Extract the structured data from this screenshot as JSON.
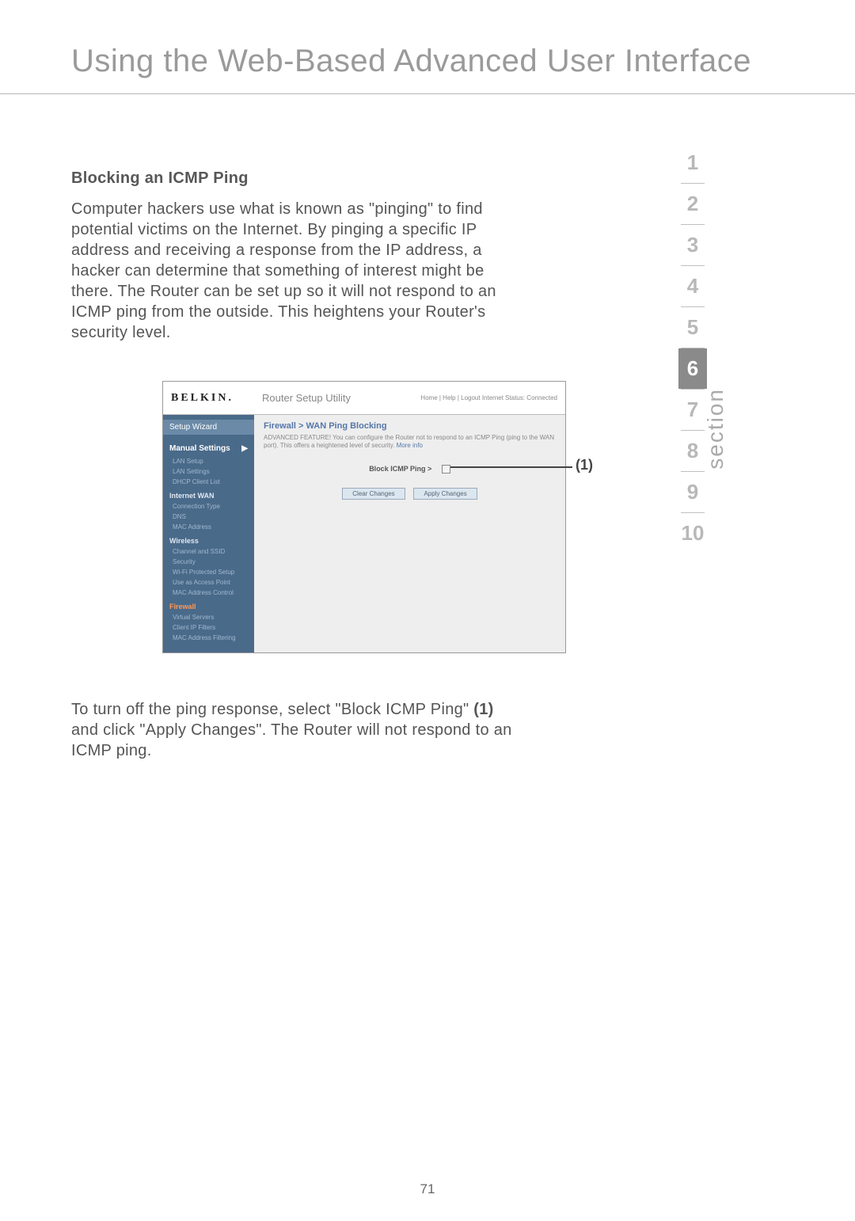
{
  "page": {
    "title": "Using the Web-Based Advanced User Interface",
    "number": "71",
    "section_word": "section"
  },
  "nav": {
    "items": [
      "1",
      "2",
      "3",
      "4",
      "5",
      "6",
      "7",
      "8",
      "9",
      "10"
    ],
    "active_index": 5
  },
  "article": {
    "subhead": "Blocking an ICMP Ping",
    "body": "Computer hackers use what is known as \"pinging\" to find potential victims on the Internet. By pinging a specific IP address and receiving a response from the IP address, a hacker can determine that something of interest might be there. The Router can be set up so it will not respond to an ICMP ping from the outside. This heightens your Router's security level.",
    "after_pre": "To turn off the ping response, select \"Block ICMP Ping\" ",
    "after_bold": "(1)",
    "after_post": " and click \"Apply Changes\". The Router will not respond to an ICMP ping."
  },
  "callout": "(1)",
  "router_shot": {
    "logo": "BELKIN.",
    "utility_title": "Router Setup Utility",
    "header_links": "Home | Help | Logout    Internet Status: Connected",
    "sidebar": {
      "wizard": "Setup Wizard",
      "manual": "Manual Settings",
      "cat1": "",
      "items1": [
        "LAN Setup",
        "LAN Settings",
        "DHCP Client List"
      ],
      "cat2": "Internet WAN",
      "items2": [
        "Connection Type",
        "DNS",
        "MAC Address"
      ],
      "cat3": "Wireless",
      "items3": [
        "Channel and SSID",
        "Security",
        "Wi-Fi Protected Setup",
        "Use as Access Point",
        "MAC Address Control"
      ],
      "cat4": "Firewall",
      "items4": [
        "Virtual Servers",
        "Client IP Filters",
        "MAC Address Filtering"
      ]
    },
    "main": {
      "crumb": "Firewall > WAN Ping Blocking",
      "desc": "ADVANCED FEATURE! You can configure the Router not to respond to an ICMP Ping (ping to the WAN port). This offers a heightened level of security.",
      "more": "More info",
      "row_label": "Block ICMP Ping >",
      "btn_clear": "Clear Changes",
      "btn_apply": "Apply Changes"
    }
  }
}
